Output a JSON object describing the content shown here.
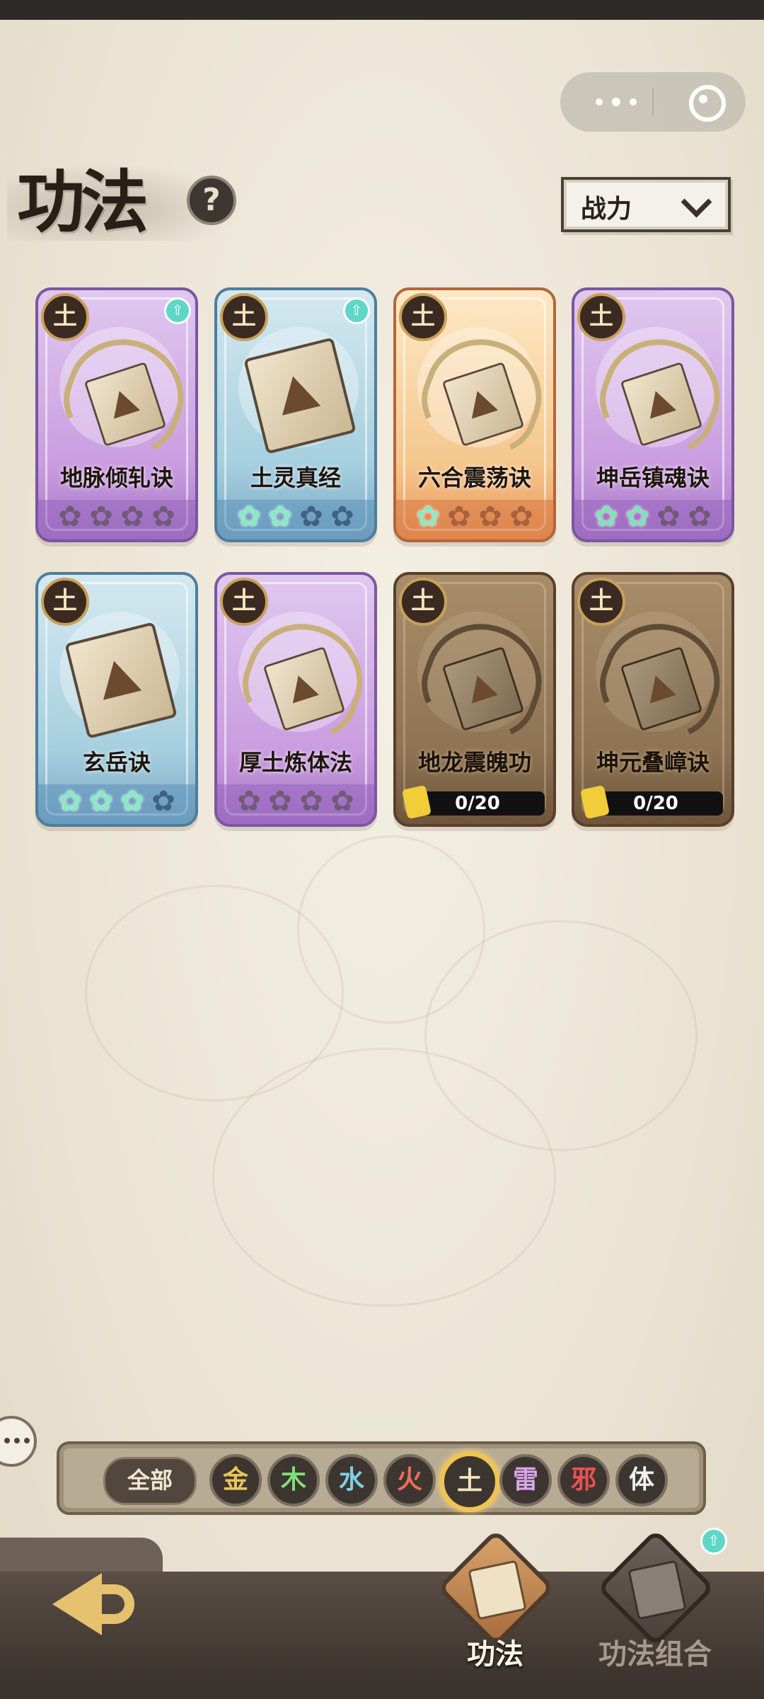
{
  "title": "功法",
  "help_icon": "question-mark-icon",
  "sort": {
    "label": "战力",
    "icon": "chevron-down-icon"
  },
  "cards": [
    {
      "name": "地脉倾轧诀",
      "element": "土",
      "rarity": "purple",
      "stars": 0,
      "max_stars": 4,
      "upgradable": true,
      "icon": "dragon-book-icon"
    },
    {
      "name": "土灵真经",
      "element": "土",
      "rarity": "blue",
      "stars": 2,
      "max_stars": 4,
      "upgradable": true,
      "icon": "book-icon"
    },
    {
      "name": "六合震荡诀",
      "element": "土",
      "rarity": "orange",
      "stars": 1,
      "max_stars": 4,
      "upgradable": false,
      "icon": "dragon-book-icon"
    },
    {
      "name": "坤岳镇魂诀",
      "element": "土",
      "rarity": "purple",
      "stars": 2,
      "max_stars": 4,
      "upgradable": false,
      "icon": "dragon-book-icon"
    },
    {
      "name": "玄岳诀",
      "element": "土",
      "rarity": "blue",
      "stars": 3,
      "max_stars": 4,
      "upgradable": false,
      "icon": "book-icon"
    },
    {
      "name": "厚土炼体法",
      "element": "土",
      "rarity": "purple",
      "stars": 0,
      "max_stars": 4,
      "upgradable": false,
      "icon": "dragon-book-icon"
    },
    {
      "name": "地龙震魄功",
      "element": "土",
      "rarity": "brown",
      "locked": true,
      "fragments": "0/20",
      "icon": "dragon-book-icon"
    },
    {
      "name": "坤元叠嶂诀",
      "element": "土",
      "rarity": "brown",
      "locked": true,
      "fragments": "0/20",
      "icon": "dragon-book-icon"
    }
  ],
  "filters": {
    "all_label": "全部",
    "elements": [
      {
        "label": "金",
        "color": "#e9c65a",
        "active": false
      },
      {
        "label": "木",
        "color": "#7fe07a",
        "active": false
      },
      {
        "label": "水",
        "color": "#7fd0ea",
        "active": false
      },
      {
        "label": "火",
        "color": "#f06b5a",
        "active": false
      },
      {
        "label": "土",
        "color": "#f2e2c0",
        "active": true
      },
      {
        "label": "雷",
        "color": "#d9a6ea",
        "active": false
      },
      {
        "label": "邪",
        "color": "#ee5151",
        "active": false
      },
      {
        "label": "体",
        "color": "#f0f0f0",
        "active": false
      }
    ]
  },
  "nav": {
    "back_icon": "back-arrow-icon",
    "tabs": [
      {
        "label": "功法",
        "active": true,
        "icon": "scroll-book-icon"
      },
      {
        "label": "功法组合",
        "active": false,
        "icon": "combo-book-icon",
        "badge_icon": "upgrade-arrow-icon"
      }
    ]
  }
}
